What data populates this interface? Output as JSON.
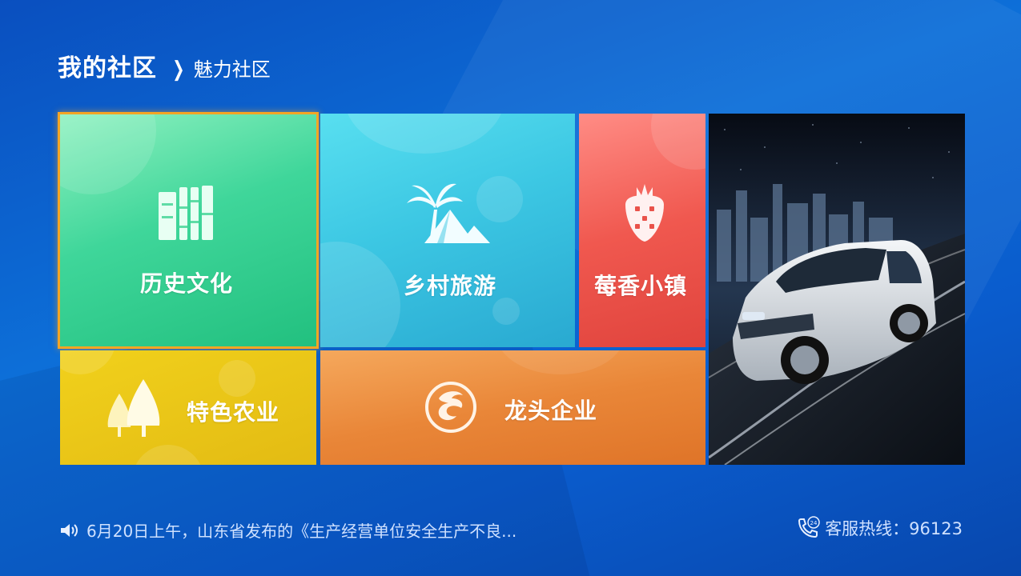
{
  "breadcrumb": {
    "root": "我的社区",
    "separator": "❯",
    "current": "魅力社区"
  },
  "tiles": [
    {
      "id": "history",
      "label": "历史文化",
      "icon": "books-icon",
      "color": "#2fcf8e",
      "focused": true
    },
    {
      "id": "tour",
      "label": "乡村旅游",
      "icon": "palm-tree-icon",
      "color": "#3cc7e3"
    },
    {
      "id": "berry",
      "label": "莓香小镇",
      "icon": "strawberry-icon",
      "color": "#e9524a"
    },
    {
      "id": "agri",
      "label": "特色农业",
      "icon": "trees-icon",
      "color": "#e6c016"
    },
    {
      "id": "dragon",
      "label": "龙头企业",
      "icon": "dragon-icon",
      "color": "#e98638"
    },
    {
      "id": "car",
      "label": "",
      "icon": "car-ad-image",
      "color": "#1d2a44"
    }
  ],
  "footer": {
    "news_text": "6月20日上午，山东省发布的《生产经营单位安全生产不良...",
    "news_icon": "speaker-icon",
    "hotline_label": "客服热线：96123",
    "hotline_icon": "phone-24h-icon"
  }
}
